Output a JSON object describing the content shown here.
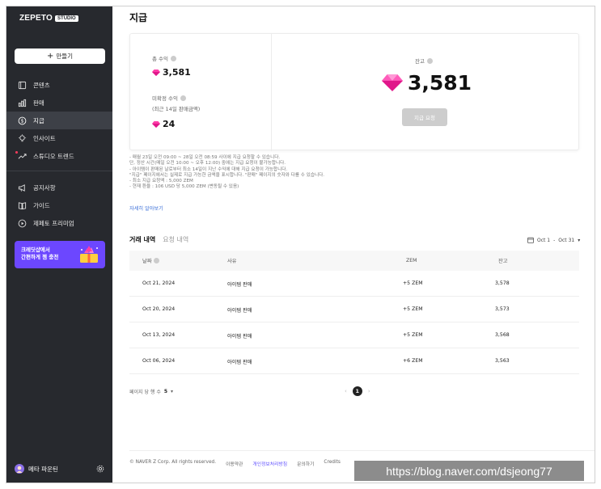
{
  "sidebar": {
    "logo_text": "ZEPETO",
    "logo_badge": "STUDIO",
    "create_label": "만들기",
    "items": [
      {
        "label": "콘텐츠",
        "icon": "content-icon"
      },
      {
        "label": "판매",
        "icon": "bar-chart-icon"
      },
      {
        "label": "지급",
        "icon": "dollar-icon"
      },
      {
        "label": "인사이트",
        "icon": "lightbulb-icon"
      },
      {
        "label": "스튜디오 트렌드",
        "icon": "trend-icon"
      }
    ],
    "items2": [
      {
        "label": "공지사항",
        "icon": "megaphone-icon"
      },
      {
        "label": "가이드",
        "icon": "book-icon"
      },
      {
        "label": "제페토 프리미엄",
        "icon": "play-icon"
      }
    ],
    "promo": {
      "line1": "크레딧샵에서",
      "line2": "간편하게 젬 충전"
    },
    "user_name": "메타 파운틴"
  },
  "page": {
    "title": "지급"
  },
  "summary": {
    "total_label": "총 수익",
    "total_value": "3,581",
    "unsettled_label": "미확정 수익",
    "unsettled_sub": "(최근 14일 판매금액)",
    "unsettled_value": "24",
    "balance_label": "잔고",
    "balance_value": "3,581",
    "withdraw_label": "지급 요청"
  },
  "notes": [
    "- 매월 23일 오전 09:00 ~ 28일 오전 08:59 사이에 지급 요청할 수 있습니다.",
    "  단, 정산 시간(매일 오전 10:00 ~ 오후 12:00) 중에는 지급 요청이 불가능합니다.",
    "- 아이템이 판매된 날로부터 최소 14일이 지난 수익에 대해 지급 요청이 가능합니다.",
    "  \"지급\" 페이지에서는 실제로 지급 가능한 금액을 표시합니다. \"판매\" 페이지의 숫자와 다를 수 있습니다.",
    "- 최소 지급 요청액 : 5,000 ZEM",
    "- 현재 환율 : 106 USD 당 5,000 ZEM (변동될 수 있음)"
  ],
  "more_link": "자세히 알아보기",
  "tabs": [
    {
      "label": "거래 내역",
      "active": true
    },
    {
      "label": "요청 내역",
      "active": false
    }
  ],
  "date_range": {
    "from": "Oct 1",
    "sep": "-",
    "to": "Oct 31"
  },
  "table": {
    "headers": [
      "날짜",
      "사유",
      "ZEM",
      "잔고"
    ],
    "rows": [
      [
        "Oct 21, 2024",
        "아이템 판매",
        "+5 ZEM",
        "3,578"
      ],
      [
        "Oct 20, 2024",
        "아이템 판매",
        "+5 ZEM",
        "3,573"
      ],
      [
        "Oct 13, 2024",
        "아이템 판매",
        "+5 ZEM",
        "3,568"
      ],
      [
        "Oct 06, 2024",
        "아이템 판매",
        "+6 ZEM",
        "3,563"
      ]
    ]
  },
  "pagination": {
    "per_page_label": "페이지 당 행 수",
    "per_page_value": "5",
    "current_page": "1",
    "prev": "‹",
    "next": "›"
  },
  "footer": {
    "copyright": "© NAVER Z Corp. All rights reserved.",
    "links": [
      "이용약관",
      "개인정보처리방침",
      "문의하기",
      "Credits"
    ]
  },
  "watermark": "https://blog.naver.com/dsjeong77",
  "colors": {
    "sidebar_bg": "#27292e",
    "accent_purple": "#6c47ff",
    "gem_pink": "#ff3ca8"
  }
}
